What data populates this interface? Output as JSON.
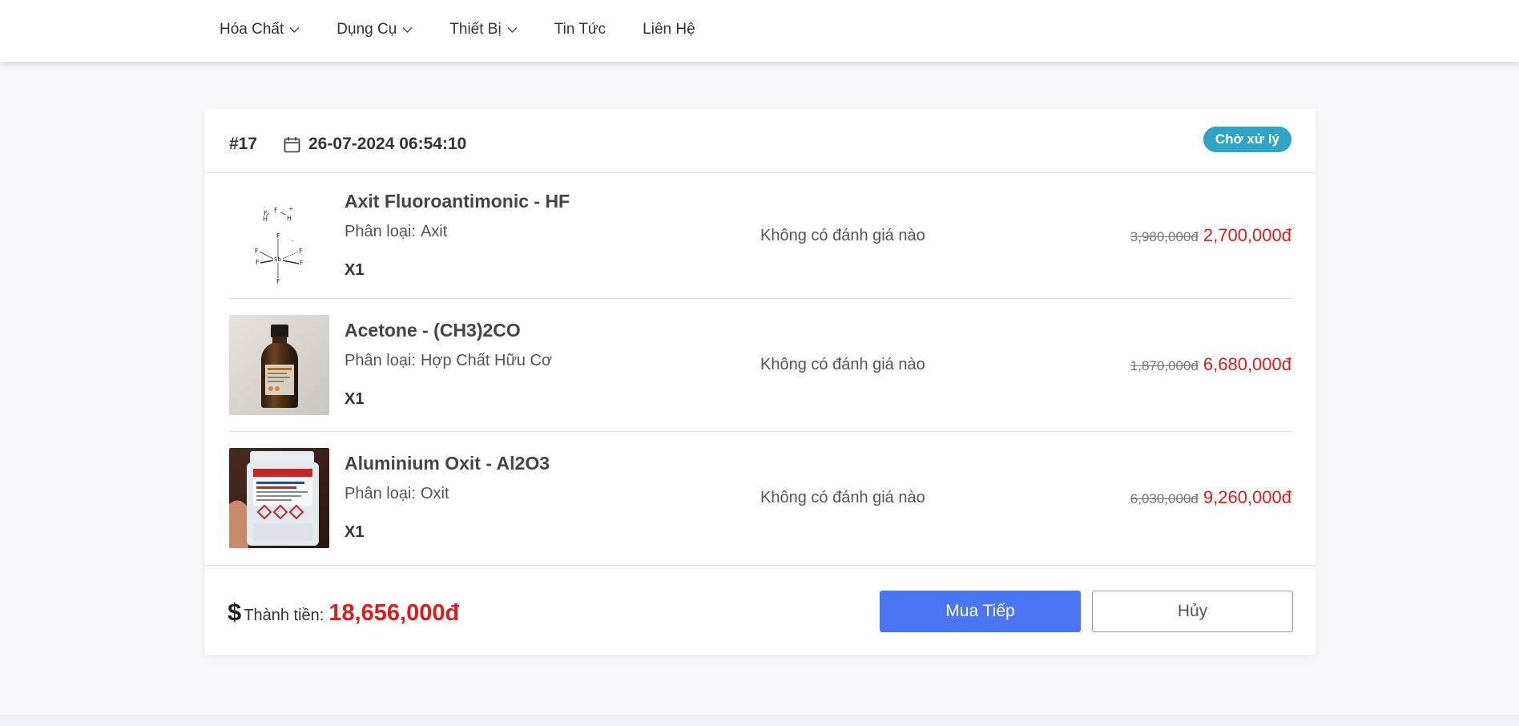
{
  "nav": {
    "items": [
      {
        "label": "Hóa Chất",
        "dropdown": true
      },
      {
        "label": "Dụng Cụ",
        "dropdown": true
      },
      {
        "label": "Thiết Bị",
        "dropdown": true
      },
      {
        "label": "Tin Tức",
        "dropdown": false
      },
      {
        "label": "Liên Hệ",
        "dropdown": false
      }
    ]
  },
  "order": {
    "id": "#17",
    "date": "26-07-2024 06:54:10",
    "status": "Chờ xử lý",
    "status_color": "#2fa4c6",
    "items": [
      {
        "name": "Axit Fluoroantimonic - HF",
        "type_label": "Phân loại:",
        "type_value": "Axit",
        "qty": "X1",
        "review": "Không có đánh giá nào",
        "old_price": "3,980,000đ",
        "new_price": "2,700,000đ",
        "image": "fluoroantimonic-structure"
      },
      {
        "name": "Acetone - (CH3)2CO",
        "type_label": "Phân loại:",
        "type_value": "Hợp Chất Hữu Cơ",
        "qty": "X1",
        "review": "Không có đánh giá nào",
        "old_price": "1,870,000đ",
        "new_price": "6,680,000đ",
        "image": "brown-bottle"
      },
      {
        "name": "Aluminium Oxit - Al2O3",
        "type_label": "Phân loại:",
        "type_value": "Oxit",
        "qty": "X1",
        "review": "Không có đánh giá nào",
        "old_price": "6,030,000đ",
        "new_price": "9,260,000đ",
        "image": "white-jar"
      }
    ],
    "total_label": "Thành tiền:",
    "total_value": "18,656,000đ",
    "buy_label": "Mua Tiếp",
    "cancel_label": "Hủy"
  },
  "colors": {
    "accent": "#4a76f3",
    "price": "#e01b1b",
    "badge": "#2fa4c6"
  }
}
